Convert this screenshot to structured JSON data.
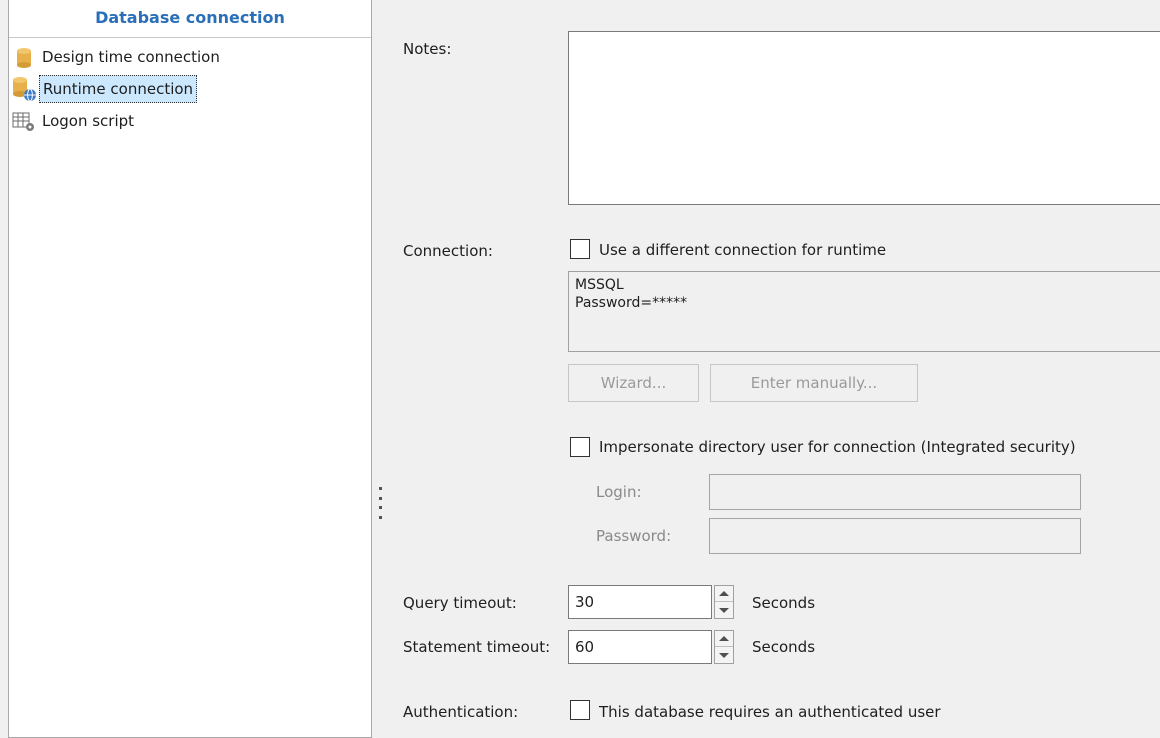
{
  "sidebar": {
    "header": "Database connection",
    "items": [
      {
        "label": "Design time connection",
        "icon": "database-icon"
      },
      {
        "label": "Runtime connection",
        "icon": "database-globe-icon",
        "selected": true
      },
      {
        "label": "Logon script",
        "icon": "table-gear-icon"
      }
    ]
  },
  "form": {
    "notes_label": "Notes:",
    "notes_value": "",
    "connection_label": "Connection:",
    "different_connection_label": "Use a different connection for runtime",
    "connection_string_line1": "MSSQL",
    "connection_string_line2": "Password=*****",
    "wizard_button": "Wizard...",
    "enter_manually_button": "Enter manually...",
    "impersonate_label": "Impersonate directory user for connection (Integrated security)",
    "login_label": "Login:",
    "login_value": "",
    "password_label": "Password:",
    "password_value": "",
    "query_timeout_label": "Query timeout:",
    "query_timeout_value": "30",
    "query_timeout_unit": "Seconds",
    "statement_timeout_label": "Statement timeout:",
    "statement_timeout_value": "60",
    "statement_timeout_unit": "Seconds",
    "authentication_label": "Authentication:",
    "authentication_checkbox_label": "This database requires an authenticated user"
  },
  "colors": {
    "header_text": "#2a6fb8",
    "selection": "#cce8ff",
    "database_icon": "#e8b04a"
  }
}
